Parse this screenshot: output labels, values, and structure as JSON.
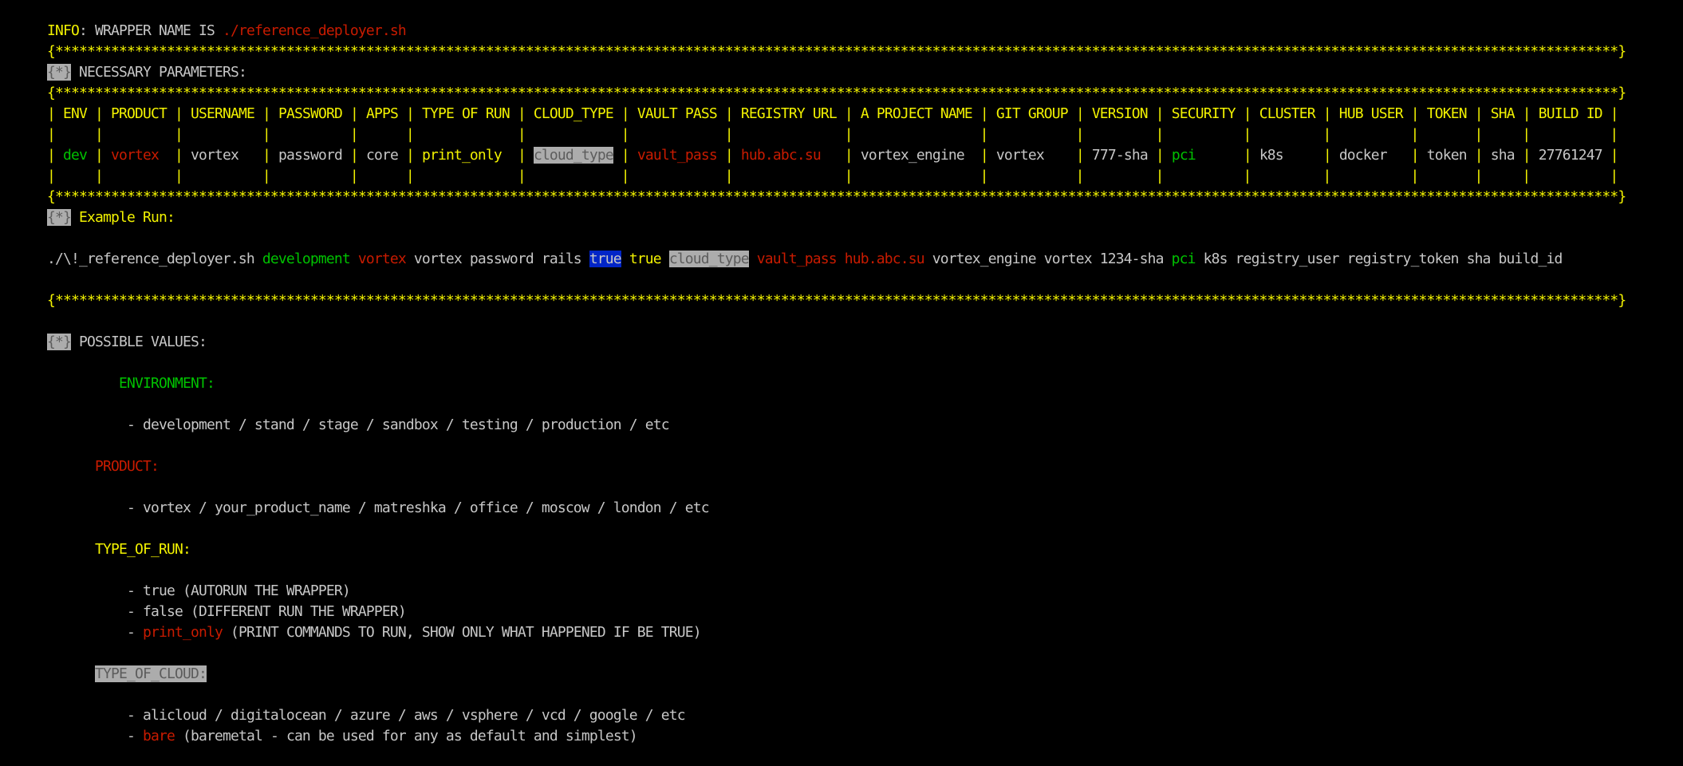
{
  "colors": {
    "yellow": "#f2f200",
    "red": "#c91b00",
    "green": "#00c200",
    "gray": "#c7c7c7",
    "highlight_bg": "#acacac",
    "selection_bg": "#0225c7",
    "background": "#000000"
  },
  "info": [
    {
      "t": "INFO",
      "c": "yellow"
    },
    {
      "t": ": WRAPPER NAME IS ",
      "c": "gray"
    },
    {
      "t": "./reference_deployer.sh",
      "c": "red"
    }
  ],
  "separator": {
    "open": "{",
    "star": "*",
    "close": "}"
  },
  "marker": "{*}",
  "necessary_title": "NECESSARY PARAMETERS:",
  "table": {
    "headers": [
      "ENV",
      "PRODUCT",
      "USERNAME",
      "PASSWORD",
      "APPS",
      "TYPE OF RUN",
      "CLOUD_TYPE",
      "VAULT PASS",
      "REGISTRY URL",
      "A PROJECT NAME",
      "GIT GROUP",
      "VERSION",
      "SECURITY",
      "CLUSTER",
      "HUB USER",
      "TOKEN",
      "SHA",
      "BUILD ID"
    ],
    "values": [
      {
        "t": "dev",
        "c": "green"
      },
      {
        "t": "vortex",
        "c": "red"
      },
      {
        "t": "vortex",
        "c": "gray"
      },
      {
        "t": "password",
        "c": "gray"
      },
      {
        "t": "core",
        "c": "gray"
      },
      {
        "t": "print_only",
        "c": "yellow"
      },
      {
        "t": "cloud_type",
        "c": "hl"
      },
      {
        "t": "vault_pass",
        "c": "red"
      },
      {
        "t": "hub.abc.su",
        "c": "red"
      },
      {
        "t": "vortex_engine",
        "c": "gray"
      },
      {
        "t": "vortex",
        "c": "gray"
      },
      {
        "t": "777-sha",
        "c": "gray"
      },
      {
        "t": "pci",
        "c": "green"
      },
      {
        "t": "k8s",
        "c": "gray"
      },
      {
        "t": "docker",
        "c": "gray"
      },
      {
        "t": "token",
        "c": "gray"
      },
      {
        "t": "sha",
        "c": "gray"
      },
      {
        "t": "27761247",
        "c": "gray"
      }
    ]
  },
  "example_title": "Example Run:",
  "example_command": [
    {
      "t": "./\\!_reference_deployer.sh ",
      "c": "gray"
    },
    {
      "t": "development",
      "c": "green"
    },
    {
      "t": " ",
      "c": "gray"
    },
    {
      "t": "vortex",
      "c": "red"
    },
    {
      "t": " vortex password rails ",
      "c": "gray"
    },
    {
      "t": "true",
      "c": "blue"
    },
    {
      "t": " ",
      "c": "gray"
    },
    {
      "t": "true",
      "c": "yellow"
    },
    {
      "t": " ",
      "c": "gray"
    },
    {
      "t": "cloud_type",
      "c": "hl"
    },
    {
      "t": " ",
      "c": "gray"
    },
    {
      "t": "vault_pass",
      "c": "red"
    },
    {
      "t": " ",
      "c": "gray"
    },
    {
      "t": "hub.abc.su",
      "c": "red"
    },
    {
      "t": " vortex_engine vortex 1234-sha ",
      "c": "gray"
    },
    {
      "t": "pci",
      "c": "green"
    },
    {
      "t": " k8s registry_user registry_token sha build_id",
      "c": "gray"
    }
  ],
  "possible_title": "POSSIBLE VALUES:",
  "sections": [
    {
      "indent": 9,
      "title": "ENVIRONMENT:",
      "c": "green",
      "items": [
        [
          {
            "t": "- development / stand / stage / sandbox / testing / production / etc",
            "c": "gray"
          }
        ]
      ]
    },
    {
      "indent": 6,
      "title": "PRODUCT:",
      "c": "red",
      "items": [
        [
          {
            "t": "- vortex / your_product_name / matreshka / office / moscow / london / etc",
            "c": "gray"
          }
        ]
      ]
    },
    {
      "indent": 6,
      "title": "TYPE_OF_RUN:",
      "c": "yellow",
      "items": [
        [
          {
            "t": "- true (AUTORUN THE WRAPPER)",
            "c": "gray"
          }
        ],
        [
          {
            "t": "- false (DIFFERENT RUN THE WRAPPER)",
            "c": "gray"
          }
        ],
        [
          {
            "t": "- ",
            "c": "gray"
          },
          {
            "t": "print_only",
            "c": "red"
          },
          {
            "t": " (PRINT COMMANDS TO RUN, SHOW ONLY WHAT HAPPENED IF BE TRUE)",
            "c": "gray"
          }
        ]
      ]
    },
    {
      "indent": 6,
      "title": "TYPE_OF_CLOUD:",
      "c": "hl",
      "items": [
        [
          {
            "t": "- alicloud / digitalocean / azure / aws / vsphere / vcd / google / etc",
            "c": "gray"
          }
        ],
        [
          {
            "t": "- ",
            "c": "gray"
          },
          {
            "t": "bare",
            "c": "red"
          },
          {
            "t": " (baremetal - can be used for any as default and simplest)",
            "c": "gray"
          }
        ]
      ]
    }
  ]
}
